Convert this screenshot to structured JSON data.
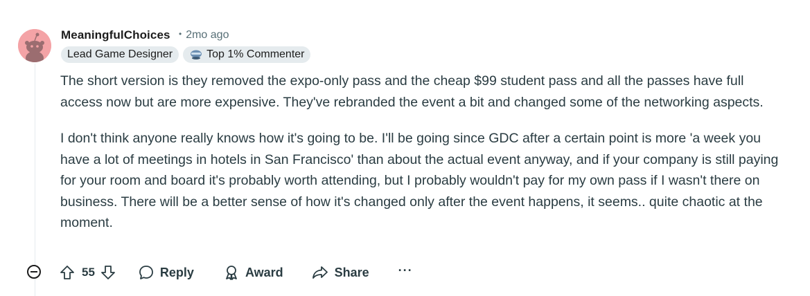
{
  "comment": {
    "author": "MeaningfulChoices",
    "time": "2mo ago",
    "separator": "•",
    "flairs": [
      {
        "label": "Lead Game Designer"
      },
      {
        "label": "Top 1% Commenter",
        "icon": "top-commenter-icon"
      }
    ],
    "paragraphs": [
      "The short version is they removed the expo-only pass and the cheap $99 student pass and all the passes have full access now but are more expensive. They've rebranded the event a bit and changed some of the networking aspects.",
      "I don't think anyone really knows how it's going to be. I'll be going since GDC after a certain point is more 'a week you have a lot of meetings in hotels in San Francisco' than about the actual event anyway, and if your company is still paying for your room and board it's probably worth attending, but I probably wouldn't pay for my own pass if I wasn't there on business. There will be a better sense of how it's changed only after the event happens, it seems.. quite chaotic at the moment."
    ],
    "votes": "55",
    "actions": {
      "reply": "Reply",
      "award": "Award",
      "share": "Share",
      "more": "···"
    }
  },
  "colors": {
    "avatar_bg": "#f4a3a6",
    "flair_bg": "#e5ebee",
    "meta_text": "#576f76",
    "body_text": "#2a3c42"
  }
}
